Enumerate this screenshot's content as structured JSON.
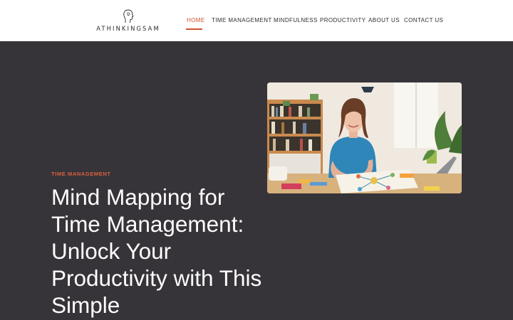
{
  "site": {
    "logo_text": "ATHINKINGSAM",
    "logo_icon": "head-silhouette-icon"
  },
  "nav": {
    "items": [
      {
        "label": "HOME",
        "active": true
      },
      {
        "label": "TIME MANAGEMENT",
        "active": false
      },
      {
        "label": "MINDFULNESS",
        "active": false
      },
      {
        "label": "PRODUCTIVITY",
        "active": false
      },
      {
        "label": "ABOUT US",
        "active": false
      },
      {
        "label": "CONTACT US",
        "active": false
      }
    ]
  },
  "article": {
    "category": "TIME MANAGEMENT",
    "title": "Mind Mapping for Time Management: Unlock Your Productivity with This Simple"
  },
  "colors": {
    "accent": "#d2522f",
    "hero_bg": "#373439",
    "header_bg": "#ffffff"
  }
}
